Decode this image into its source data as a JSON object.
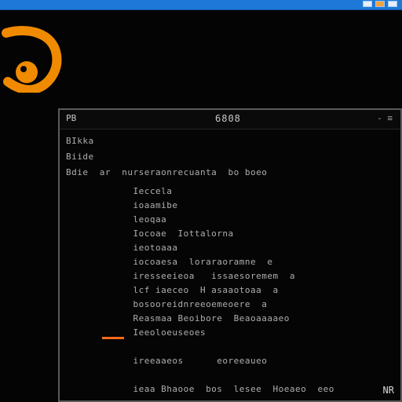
{
  "colors": {
    "accent": "#ff6a1a",
    "topbar": "#1e78d8",
    "window_border": "#5a5a5a"
  },
  "icons": {
    "logo": "orange-swirl-logo-icon",
    "tray": [
      "tray-icon",
      "tray-icon",
      "tray-icon"
    ]
  },
  "window": {
    "title": "6808",
    "corner_label": "PB",
    "corner_controls": "-  ≡"
  },
  "terminal": {
    "lines": [
      "BIkka",
      "Biide",
      "Bdie  ar  nurseraonrecuanta  bo boeo",
      "            Ieccela",
      "            ioaamibe",
      "            leoqaa",
      "            Iocoae  Iottalorna",
      "            ieotoaaa",
      "            iocoaesa  loraraoramne  e",
      "            iresseeieoa   issaesoremem  a",
      "            lcf iaeceo  H asaaotoaa  a",
      "            bosooreidnreeoemeoere  a",
      "            Reasmaa Beoibore  Beaoaaaaeo",
      "            Ieeoloeuseoes",
      "",
      "            ireeaaeos      eoreeaueo",
      "",
      "            ieaa Bhaooe  bos  lesee  Hoeaeo  eeo"
    ]
  },
  "status": {
    "text": "NR"
  }
}
